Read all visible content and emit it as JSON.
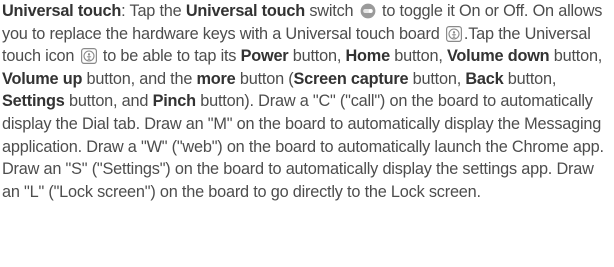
{
  "paragraph": {
    "t01": "Universal touch",
    "t02": ": Tap the ",
    "t03": "Universal touch",
    "t04": " switch ",
    "t05": " to toggle it On or Off. On allows you to replace the hardware keys with a Universal touch board ",
    "t06": ".Tap the Universal touch icon ",
    "t07": " to be able to tap its ",
    "t08": "Power",
    "t09": " button, ",
    "t10": "Home",
    "t11": " button, ",
    "t12": "Volume down",
    "t13": " button, ",
    "t14": "Volume up",
    "t15": " button, and the ",
    "t16": "more",
    "t17": " button (",
    "t18": "Screen capture",
    "t19": " button, ",
    "t20": "Back",
    "t21": " button, ",
    "t22": "Settings",
    "t23": " button, and ",
    "t24": "Pinch",
    "t25": " button). Draw a \"C\" (\"call\") on the board to automatically display the Dial tab. Draw an \"M\" on the board to automatically display the Messaging application. Draw a \"W\" (\"web\") on the board to automatically launch the Chrome app. Draw an \"S\" (\"Settings\") on the board to automatically display the settings app. Draw an \"L\" (\"Lock screen\") on the board to go directly to the Lock screen."
  },
  "icons": {
    "switch": "toggle-switch-icon",
    "board": "universal-touch-icon",
    "touch": "universal-touch-icon"
  },
  "colors": {
    "text": "#4d4d4d",
    "bold": "#333333",
    "icon_gray": "#8a8a8a"
  }
}
